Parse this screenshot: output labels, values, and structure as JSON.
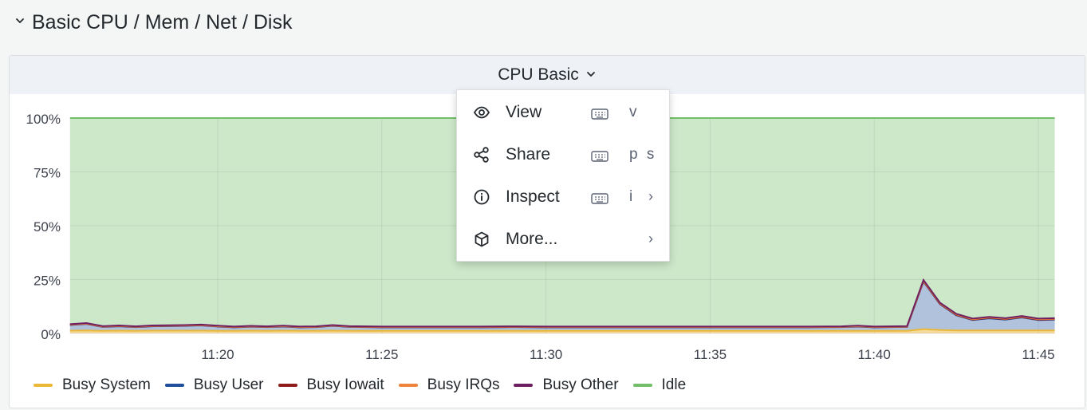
{
  "row": {
    "title": "Basic CPU / Mem / Net / Disk",
    "icon": "chevron-down-icon"
  },
  "panel": {
    "title": "CPU Basic",
    "title_icon": "chevron-down-icon"
  },
  "menu": {
    "items": [
      {
        "label": "View",
        "icon": "eye-icon",
        "shortcut": "v",
        "keyboard_icon": true,
        "submenu": false
      },
      {
        "label": "Share",
        "icon": "share-icon",
        "shortcut": "p s",
        "keyboard_icon": true,
        "submenu": false
      },
      {
        "label": "Inspect",
        "icon": "info-circle-icon",
        "shortcut": "i",
        "keyboard_icon": true,
        "submenu": true
      },
      {
        "label": "More...",
        "icon": "cube-icon",
        "shortcut": "",
        "keyboard_icon": false,
        "submenu": true
      }
    ],
    "submenu_arrow": "›"
  },
  "chart_data": {
    "type": "area",
    "stacked": true,
    "x_unit": "time",
    "x_tick_labels": [
      "11:20",
      "11:25",
      "11:30",
      "11:35",
      "11:40",
      "11:45"
    ],
    "y_tick_labels": [
      "0%",
      "25%",
      "50%",
      "75%",
      "100%"
    ],
    "ylim": [
      0,
      100
    ],
    "grid": true,
    "legend_placement": "bottom-left",
    "x": [
      "11:15:30",
      "11:16",
      "11:16:30",
      "11:17",
      "11:17:30",
      "11:18",
      "11:18:30",
      "11:19",
      "11:19:30",
      "11:20",
      "11:20:30",
      "11:21",
      "11:21:30",
      "11:22",
      "11:22:30",
      "11:23",
      "11:23:30",
      "11:24",
      "11:24:30",
      "11:25",
      "11:26",
      "11:27",
      "11:28",
      "11:29",
      "11:30",
      "11:31",
      "11:32",
      "11:33",
      "11:34",
      "11:35",
      "11:36",
      "11:37",
      "11:38",
      "11:39",
      "11:39:30",
      "11:40",
      "11:40:30",
      "11:41",
      "11:41:30",
      "11:42",
      "11:42:30",
      "11:43",
      "11:43:30",
      "11:44",
      "11:44:30",
      "11:45",
      "11:45:30"
    ],
    "series": [
      {
        "name": "Busy System",
        "color": "#eab839",
        "values": [
          1.3,
          1.4,
          1.2,
          1.3,
          1.2,
          1.3,
          1.3,
          1.3,
          1.3,
          1.2,
          1.2,
          1.3,
          1.2,
          1.3,
          1.2,
          1.2,
          1.3,
          1.2,
          1.2,
          1.2,
          1.2,
          1.2,
          1.2,
          1.2,
          1.2,
          1.2,
          1.2,
          1.2,
          1.2,
          1.2,
          1.2,
          1.2,
          1.2,
          1.2,
          1.2,
          1.2,
          1.2,
          1.2,
          2.0,
          1.6,
          1.4,
          1.4,
          1.4,
          1.4,
          1.4,
          1.4,
          1.4
        ]
      },
      {
        "name": "Busy User",
        "color": "#1f4f9d",
        "values": [
          2.6,
          3.0,
          1.8,
          2.0,
          1.7,
          2.0,
          2.1,
          2.2,
          2.4,
          2.0,
          1.6,
          1.8,
          1.7,
          1.9,
          1.6,
          1.7,
          2.2,
          1.8,
          1.7,
          1.6,
          1.6,
          1.6,
          1.6,
          1.7,
          1.6,
          1.6,
          1.6,
          1.6,
          1.6,
          1.6,
          1.6,
          1.6,
          1.6,
          1.7,
          2.0,
          1.6,
          1.7,
          1.8,
          22.0,
          12.0,
          7.0,
          4.8,
          5.6,
          5.0,
          6.0,
          4.8,
          5.0
        ]
      },
      {
        "name": "Busy Iowait",
        "color": "#8f1c1c",
        "values": [
          0.1,
          0.1,
          0.1,
          0.1,
          0.1,
          0.1,
          0.1,
          0.1,
          0.1,
          0.1,
          0.1,
          0.1,
          0.1,
          0.1,
          0.1,
          0.1,
          0.1,
          0.1,
          0.1,
          0.1,
          0.1,
          0.1,
          0.1,
          0.1,
          0.1,
          0.1,
          0.1,
          0.1,
          0.1,
          0.1,
          0.1,
          0.1,
          0.1,
          0.1,
          0.1,
          0.1,
          0.1,
          0.1,
          0.2,
          0.2,
          0.2,
          0.2,
          0.2,
          0.2,
          0.2,
          0.2,
          0.2
        ]
      },
      {
        "name": "Busy IRQs",
        "color": "#ef843c",
        "values": [
          0.1,
          0.1,
          0.1,
          0.1,
          0.1,
          0.1,
          0.1,
          0.1,
          0.1,
          0.1,
          0.1,
          0.1,
          0.1,
          0.1,
          0.1,
          0.1,
          0.1,
          0.1,
          0.1,
          0.1,
          0.1,
          0.1,
          0.1,
          0.1,
          0.1,
          0.1,
          0.1,
          0.1,
          0.1,
          0.1,
          0.1,
          0.1,
          0.1,
          0.1,
          0.1,
          0.1,
          0.1,
          0.1,
          0.2,
          0.2,
          0.2,
          0.2,
          0.2,
          0.2,
          0.2,
          0.2,
          0.2
        ]
      },
      {
        "name": "Busy Other",
        "color": "#6d1f62",
        "values": [
          0.2,
          0.2,
          0.2,
          0.2,
          0.2,
          0.2,
          0.2,
          0.2,
          0.2,
          0.2,
          0.2,
          0.2,
          0.2,
          0.2,
          0.2,
          0.2,
          0.2,
          0.2,
          0.2,
          0.2,
          0.2,
          0.2,
          0.2,
          0.2,
          0.2,
          0.2,
          0.2,
          0.2,
          0.2,
          0.2,
          0.2,
          0.2,
          0.2,
          0.2,
          0.2,
          0.2,
          0.2,
          0.2,
          0.4,
          0.3,
          0.3,
          0.3,
          0.3,
          0.3,
          0.3,
          0.3,
          0.3
        ]
      },
      {
        "name": "Idle",
        "color": "#73bf69",
        "values": [
          95.7,
          95.2,
          96.6,
          96.3,
          96.7,
          96.3,
          96.2,
          96.1,
          95.9,
          96.4,
          96.8,
          96.5,
          96.7,
          96.4,
          96.8,
          96.7,
          96.1,
          96.6,
          96.7,
          96.8,
          96.8,
          96.8,
          96.8,
          96.7,
          96.8,
          96.8,
          96.8,
          96.8,
          96.8,
          96.8,
          96.8,
          96.8,
          96.8,
          96.7,
          96.4,
          96.8,
          96.7,
          96.6,
          75.2,
          85.7,
          90.9,
          93.1,
          92.3,
          92.9,
          91.9,
          93.1,
          92.9
        ]
      }
    ]
  }
}
